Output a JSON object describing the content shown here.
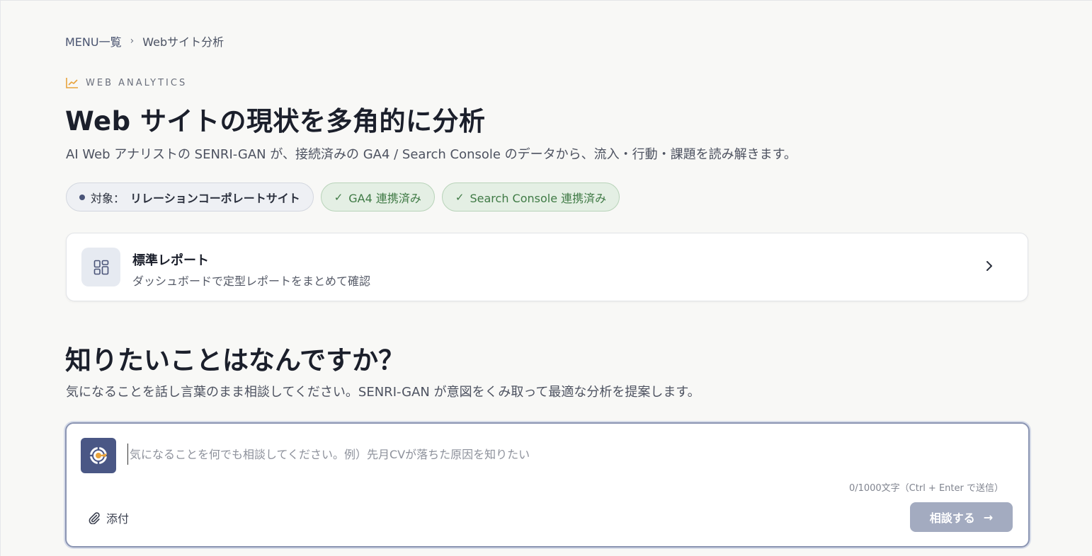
{
  "breadcrumb": {
    "root": "MENU一覧",
    "separator": "›",
    "current": "Webサイト分析"
  },
  "eyebrow": {
    "icon": "chart-line-icon",
    "label": "WEB ANALYTICS"
  },
  "header": {
    "title": "Web サイトの現状を多角的に分析",
    "description": "AI Web アナリストの SENRI-GAN が、接続済みの GA4 / Search Console のデータから、流入・行動・課題を読み解きます。"
  },
  "badges": {
    "target_label": "対象：",
    "target_value": "リレーションコーポレートサイト",
    "ga4": "GA4 連携済み",
    "search_console": "Search Console 連携済み",
    "check_icon": "✓"
  },
  "report_card": {
    "icon": "dashboard-grid-icon",
    "title": "標準レポート",
    "subtitle": "ダッシュボードで定型レポートをまとめて確認"
  },
  "question": {
    "title": "知りたいことはなんですか？",
    "description": "気になることを話し言葉のまま相談してください。SENRI-GAN が意図をくみ取って最適な分析を提案します。"
  },
  "chat": {
    "placeholder": "気になることを何でも相談してください。例）先月CVが落ちた原因を知りたい",
    "value": "",
    "counter": "0/1000文字（Ctrl + Enter で送信）",
    "attach_label": "添付",
    "send_label": "相談する",
    "send_arrow": "→"
  },
  "colors": {
    "accent": "#4a5785",
    "success_bg": "#e4efe4",
    "success_text": "#3f7a45",
    "eyebrow_icon": "#e8a33c",
    "send_disabled": "#a3abc0"
  }
}
